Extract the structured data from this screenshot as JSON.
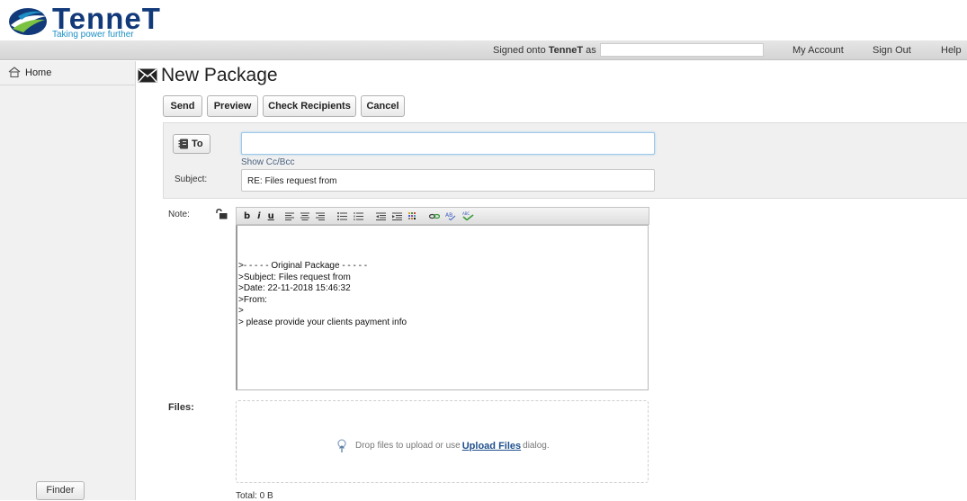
{
  "brand": {
    "name": "TenneT",
    "tagline": "Taking power further"
  },
  "topbar": {
    "signed_prefix": "Signed onto ",
    "signed_app": "TenneT",
    "signed_suffix": " as",
    "nav": [
      {
        "label": "My Account"
      },
      {
        "label": "Sign Out"
      },
      {
        "label": "Help"
      }
    ]
  },
  "sidebar": {
    "home_label": "Home",
    "finder_label": "Finder"
  },
  "page": {
    "title": "New Package"
  },
  "toolbar": {
    "send": "Send",
    "preview": "Preview",
    "check_recipients": "Check Recipients",
    "cancel": "Cancel"
  },
  "recipients": {
    "to_label": "To",
    "to_value": "",
    "show_cc": "Show Cc/Bcc",
    "subject_label": "Subject:",
    "subject_value": "RE: Files request from"
  },
  "note": {
    "label": "Note:",
    "toolbar": [
      "b",
      "i",
      "u"
    ],
    "lines": [
      ">- - - - - Original Package - - - - -",
      ">Subject: Files request from",
      ">Date: 22-11-2018 15:46:32",
      ">From:",
      ">",
      "> please provide your clients payment info"
    ]
  },
  "files": {
    "label": "Files:",
    "drop_prefix": "Drop files to upload or use",
    "drop_link": "Upload Files",
    "drop_suffix": "dialog.",
    "total": "Total: 0 B"
  },
  "icons": {
    "home": "home-icon",
    "mail": "envelope-icon",
    "to": "address-book-icon",
    "lock": "unlock-icon",
    "upload": "upload-icon"
  },
  "colors": {
    "brand_blue": "#123a7a",
    "brand_cyan": "#1d8fc4",
    "link": "#1f4f8c"
  }
}
